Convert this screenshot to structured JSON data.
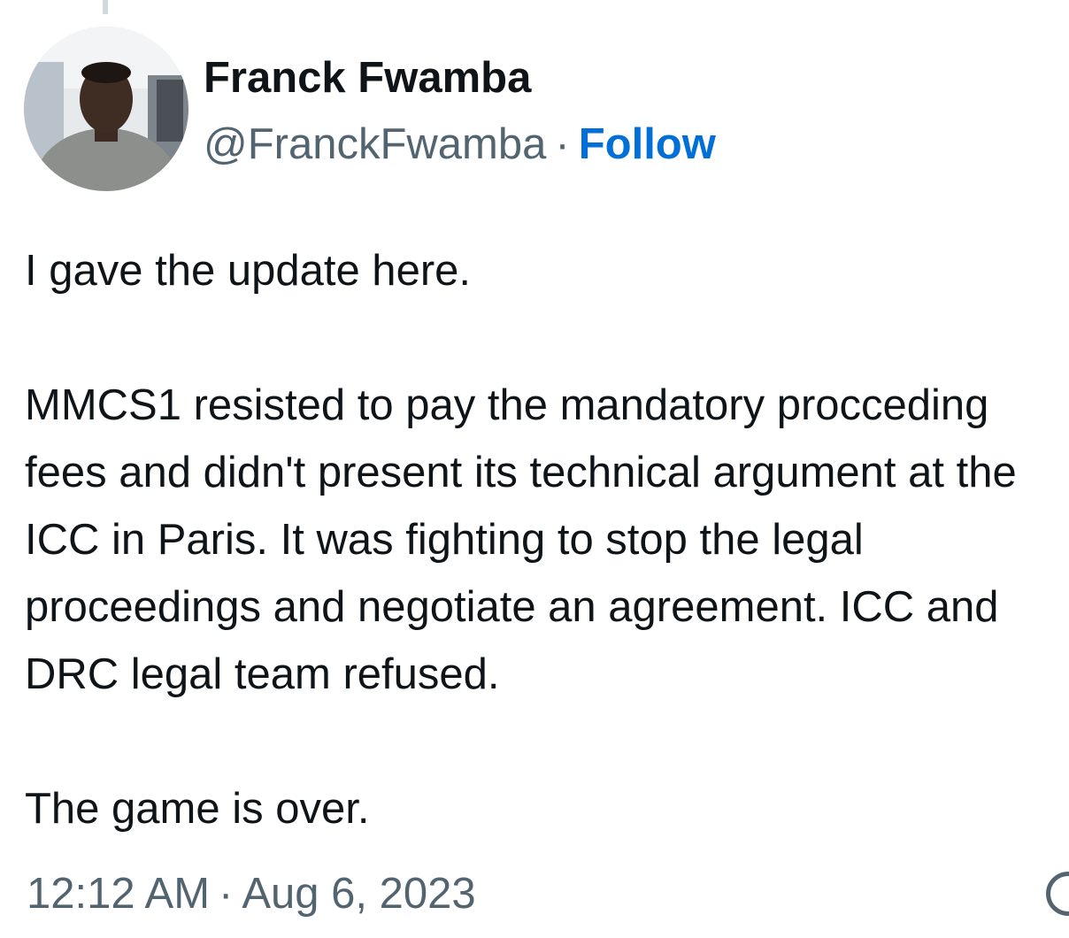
{
  "tweet": {
    "author": {
      "display_name": "Franck Fwamba",
      "handle": "@FranckFwamba"
    },
    "follow_label": "Follow",
    "separator": "·",
    "text": {
      "line1": "I gave the update here.",
      "paragraph2": "MMCS1 resisted to pay the mandatory procceding fees and didn't present its technical argument at the ICC in Paris. It was fighting to stop the legal proceedings and negotiate an agreement. ICC and DRC legal team refused.",
      "line3": "The game is over."
    },
    "time": "12:12 AM",
    "date": "Aug 6, 2023"
  },
  "icons": {
    "info": "info-icon"
  },
  "colors": {
    "text_primary": "#0f1419",
    "text_secondary": "#536471",
    "link": "#006fd6",
    "thread_line": "#cfd9de"
  }
}
